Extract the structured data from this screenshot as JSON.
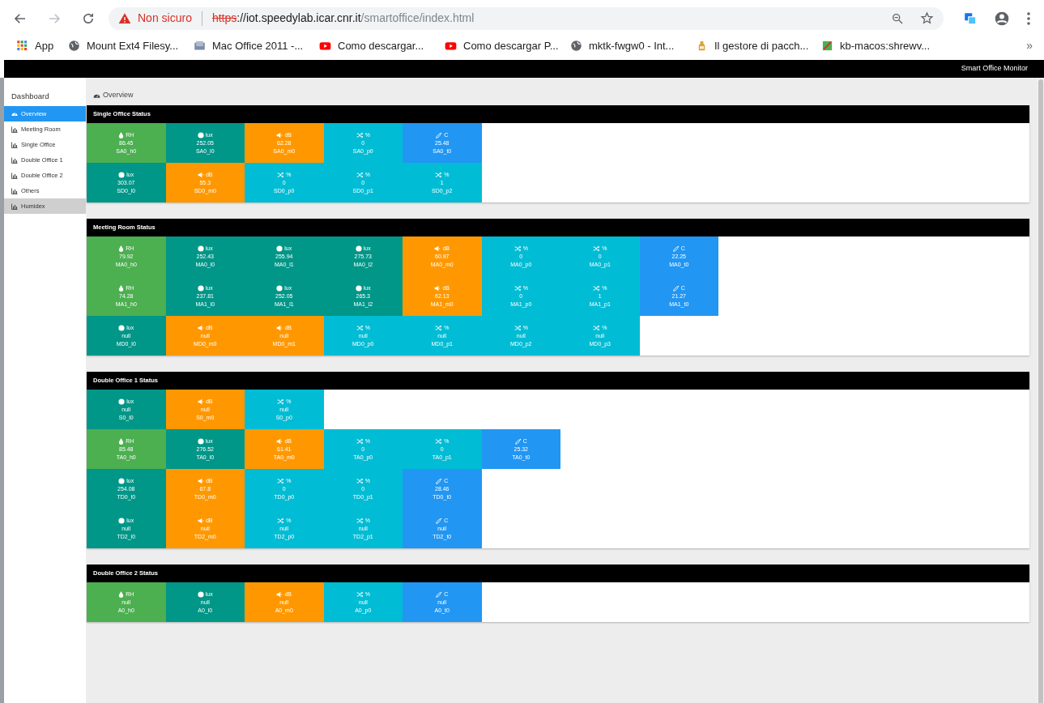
{
  "browser": {
    "security": "Non sicuro",
    "scheme": "https",
    "host": "://iot.speedylab.icar.cnr.it",
    "path": "/smartoffice/index.html",
    "bookmarks": [
      {
        "kind": "apps",
        "label": "App"
      },
      {
        "kind": "globe",
        "label": "Mount Ext4 Filesy..."
      },
      {
        "kind": "mac",
        "label": "Mac Office 2011 -..."
      },
      {
        "kind": "video",
        "label": "Como descargar..."
      },
      {
        "kind": "video",
        "label": "Como descargar P..."
      },
      {
        "kind": "globe",
        "label": "mktk-fwgw0 - Int..."
      },
      {
        "kind": "package",
        "label": "Il gestore di pacch..."
      },
      {
        "kind": "pen",
        "label": "kb-macos:shrewv..."
      }
    ],
    "more": "»"
  },
  "app_title": "Smart Office Monitor",
  "sidebar": {
    "title": "Dashboard",
    "items": [
      {
        "label": "Overview",
        "kind": "gauge",
        "selected": true,
        "highlighted": false
      },
      {
        "label": "Meeting Room",
        "kind": "chart",
        "selected": false,
        "highlighted": false
      },
      {
        "label": "Single Office",
        "kind": "chart",
        "selected": false,
        "highlighted": false
      },
      {
        "label": "Double Office 1",
        "kind": "chart",
        "selected": false,
        "highlighted": false
      },
      {
        "label": "Double Office 2",
        "kind": "chart",
        "selected": false,
        "highlighted": false
      },
      {
        "label": "Others",
        "kind": "chart",
        "selected": false,
        "highlighted": false
      },
      {
        "label": "Humidex",
        "kind": "chart",
        "selected": false,
        "highlighted": true
      }
    ]
  },
  "breadcrumb": "Overview",
  "sections": [
    {
      "title": "Single Office Status",
      "rows": [
        [
          {
            "kind": "rh",
            "unit": "RH",
            "value": "86.45",
            "id": "SA0_h0"
          },
          {
            "kind": "lux",
            "unit": "lux",
            "value": "252.05",
            "id": "SA0_l0"
          },
          {
            "kind": "db",
            "unit": "dB",
            "value": "62.28",
            "id": "SA0_m0"
          },
          {
            "kind": "pct",
            "unit": "%",
            "value": "0",
            "id": "SA0_p0"
          },
          {
            "kind": "temp",
            "unit": "C",
            "value": "25.48",
            "id": "SA0_t0"
          }
        ],
        [
          {
            "kind": "lux",
            "unit": "lux",
            "value": "303.07",
            "id": "SD0_l0"
          },
          {
            "kind": "db",
            "unit": "dB",
            "value": "55.3",
            "id": "SD0_m0"
          },
          {
            "kind": "pct",
            "unit": "%",
            "value": "0",
            "id": "SD0_p0"
          },
          {
            "kind": "pct",
            "unit": "%",
            "value": "0",
            "id": "SD0_p1"
          },
          {
            "kind": "pct",
            "unit": "%",
            "value": "1",
            "id": "SD0_p2"
          }
        ]
      ]
    },
    {
      "title": "Meeting Room Status",
      "rows": [
        [
          {
            "kind": "rh",
            "unit": "RH",
            "value": "79.92",
            "id": "MA0_h0"
          },
          {
            "kind": "lux",
            "unit": "lux",
            "value": "252.43",
            "id": "MA0_l0"
          },
          {
            "kind": "lux",
            "unit": "lux",
            "value": "255.94",
            "id": "MA0_l1"
          },
          {
            "kind": "lux",
            "unit": "lux",
            "value": "275.73",
            "id": "MA0_l2"
          },
          {
            "kind": "db",
            "unit": "dB",
            "value": "60.97",
            "id": "MA0_m0"
          },
          {
            "kind": "pct",
            "unit": "%",
            "value": "0",
            "id": "MA0_p0"
          },
          {
            "kind": "pct",
            "unit": "%",
            "value": "0",
            "id": "MA0_p1"
          },
          {
            "kind": "temp",
            "unit": "C",
            "value": "22.25",
            "id": "MA0_t0"
          }
        ],
        [
          {
            "kind": "rh",
            "unit": "RH",
            "value": "74.28",
            "id": "MA1_h0"
          },
          {
            "kind": "lux",
            "unit": "lux",
            "value": "237.81",
            "id": "MA1_l0"
          },
          {
            "kind": "lux",
            "unit": "lux",
            "value": "252.05",
            "id": "MA1_l1"
          },
          {
            "kind": "lux",
            "unit": "lux",
            "value": "265.3",
            "id": "MA1_l2"
          },
          {
            "kind": "db",
            "unit": "dB",
            "value": "62.13",
            "id": "MA1_m0"
          },
          {
            "kind": "pct",
            "unit": "%",
            "value": "0",
            "id": "MA1_p0"
          },
          {
            "kind": "pct",
            "unit": "%",
            "value": "1",
            "id": "MA1_p1"
          },
          {
            "kind": "temp",
            "unit": "C",
            "value": "21.27",
            "id": "MA1_t0"
          }
        ],
        [
          {
            "kind": "lux",
            "unit": "lux",
            "value": "null",
            "id": "MD0_l0"
          },
          {
            "kind": "db",
            "unit": "dB",
            "value": "null",
            "id": "MD0_m0"
          },
          {
            "kind": "db",
            "unit": "dB",
            "value": "null",
            "id": "MD0_m1"
          },
          {
            "kind": "pct",
            "unit": "%",
            "value": "null",
            "id": "MD0_p0"
          },
          {
            "kind": "pct",
            "unit": "%",
            "value": "null",
            "id": "MD0_p1"
          },
          {
            "kind": "pct",
            "unit": "%",
            "value": "null",
            "id": "MD0_p2"
          },
          {
            "kind": "pct",
            "unit": "%",
            "value": "null",
            "id": "MD0_p3"
          }
        ]
      ]
    },
    {
      "title": "Double Office 1 Status",
      "rows": [
        [
          {
            "kind": "lux",
            "unit": "lux",
            "value": "null",
            "id": "S0_l0"
          },
          {
            "kind": "db",
            "unit": "dB",
            "value": "null",
            "id": "S0_m0"
          },
          {
            "kind": "pct",
            "unit": "%",
            "value": "null",
            "id": "S0_p0"
          }
        ],
        [
          {
            "kind": "rh",
            "unit": "RH",
            "value": "85.48",
            "id": "TA0_h0"
          },
          {
            "kind": "lux",
            "unit": "lux",
            "value": "276.52",
            "id": "TA0_l0"
          },
          {
            "kind": "db",
            "unit": "dB",
            "value": "61.41",
            "id": "TA0_m0"
          },
          {
            "kind": "pct",
            "unit": "%",
            "value": "0",
            "id": "TA0_p0"
          },
          {
            "kind": "pct",
            "unit": "%",
            "value": "0",
            "id": "TA0_p1"
          },
          {
            "kind": "temp",
            "unit": "C",
            "value": "25.32",
            "id": "TA0_t0"
          }
        ],
        [
          {
            "kind": "lux",
            "unit": "lux",
            "value": "254.08",
            "id": "TD0_l0"
          },
          {
            "kind": "db",
            "unit": "dB",
            "value": "67.8",
            "id": "TD0_m0"
          },
          {
            "kind": "pct",
            "unit": "%",
            "value": "0",
            "id": "TD0_p0"
          },
          {
            "kind": "pct",
            "unit": "%",
            "value": "0",
            "id": "TD0_p1"
          },
          {
            "kind": "temp",
            "unit": "C",
            "value": "28.46",
            "id": "TD0_t0"
          }
        ],
        [
          {
            "kind": "lux",
            "unit": "lux",
            "value": "null",
            "id": "TD2_l0"
          },
          {
            "kind": "db",
            "unit": "dB",
            "value": "null",
            "id": "TD2_m0"
          },
          {
            "kind": "pct",
            "unit": "%",
            "value": "null",
            "id": "TD2_p0"
          },
          {
            "kind": "pct",
            "unit": "%",
            "value": "null",
            "id": "TD2_p1"
          },
          {
            "kind": "temp",
            "unit": "C",
            "value": "null",
            "id": "TD2_t0"
          }
        ]
      ]
    },
    {
      "title": "Double Office 2 Status",
      "rows": [
        [
          {
            "kind": "rh",
            "unit": "RH",
            "value": "null",
            "id": "A0_h0"
          },
          {
            "kind": "lux",
            "unit": "lux",
            "value": "null",
            "id": "A0_l0"
          },
          {
            "kind": "db",
            "unit": "dB",
            "value": "null",
            "id": "A0_m0"
          },
          {
            "kind": "pct",
            "unit": "%",
            "value": "null",
            "id": "A0_p0"
          },
          {
            "kind": "temp",
            "unit": "C",
            "value": "null",
            "id": "A0_t0"
          }
        ]
      ]
    }
  ]
}
